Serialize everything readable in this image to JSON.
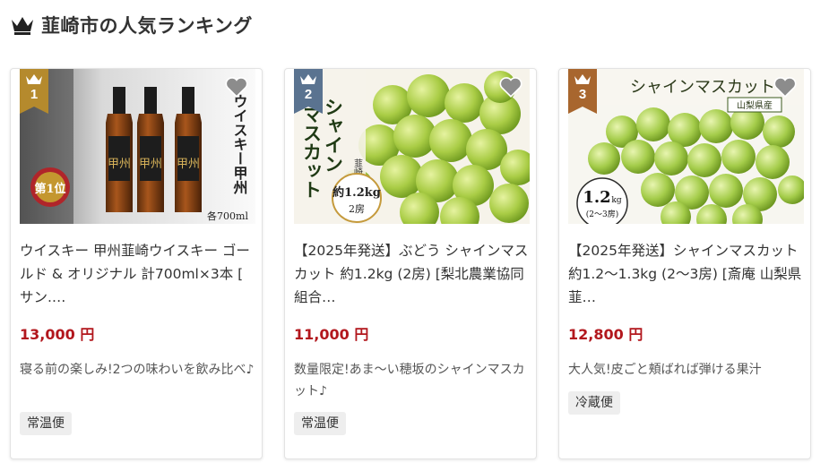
{
  "section": {
    "title": "韮崎市の人気ランキング",
    "icon": "crown-icon"
  },
  "colors": {
    "rank1": "#b58a2d",
    "rank2": "#5a7390",
    "rank3": "#a8662e",
    "price": "#b2171d"
  },
  "items": [
    {
      "rank": "1",
      "title": "ウイスキー 甲州韮崎ウイスキー ゴールド & オリジナル 計700ml×3本 [ サン.…",
      "price": "13,000 円",
      "description": "寝る前の楽しみ!2つの味わいを飲み比べ♪",
      "tag": "常温便",
      "image_text": {
        "vertical": "ウイスキー甲州",
        "badge": "第1位",
        "volume": "各700ml",
        "bottle": "甲州"
      }
    },
    {
      "rank": "2",
      "title": "【2025年発送】ぶどう シャインマスカット 約1.2kg (2房) [梨北農業協同組合…",
      "price": "11,000 円",
      "description": "数量限定!あま〜い穂坂のシャインマスカット♪",
      "tag": "常温便",
      "image_text": {
        "vertical1": "シャイン",
        "vertical2": "マスカット",
        "place": "韮崎市産",
        "weight": "約1.2kg",
        "count": "2房"
      }
    },
    {
      "rank": "3",
      "title": "【2025年発送】シャインマスカット 約1.2〜1.3kg (2〜3房) [斎庵 山梨県 韮…",
      "price": "12,800 円",
      "description": "大人気!皮ごと頬ばれば弾ける果汁",
      "tag": "冷蔵便",
      "image_text": {
        "headline": "シャインマスカット",
        "place": "山梨県産",
        "weight": "1.2",
        "unit": "kg",
        "count": "(2〜3房)"
      }
    }
  ]
}
